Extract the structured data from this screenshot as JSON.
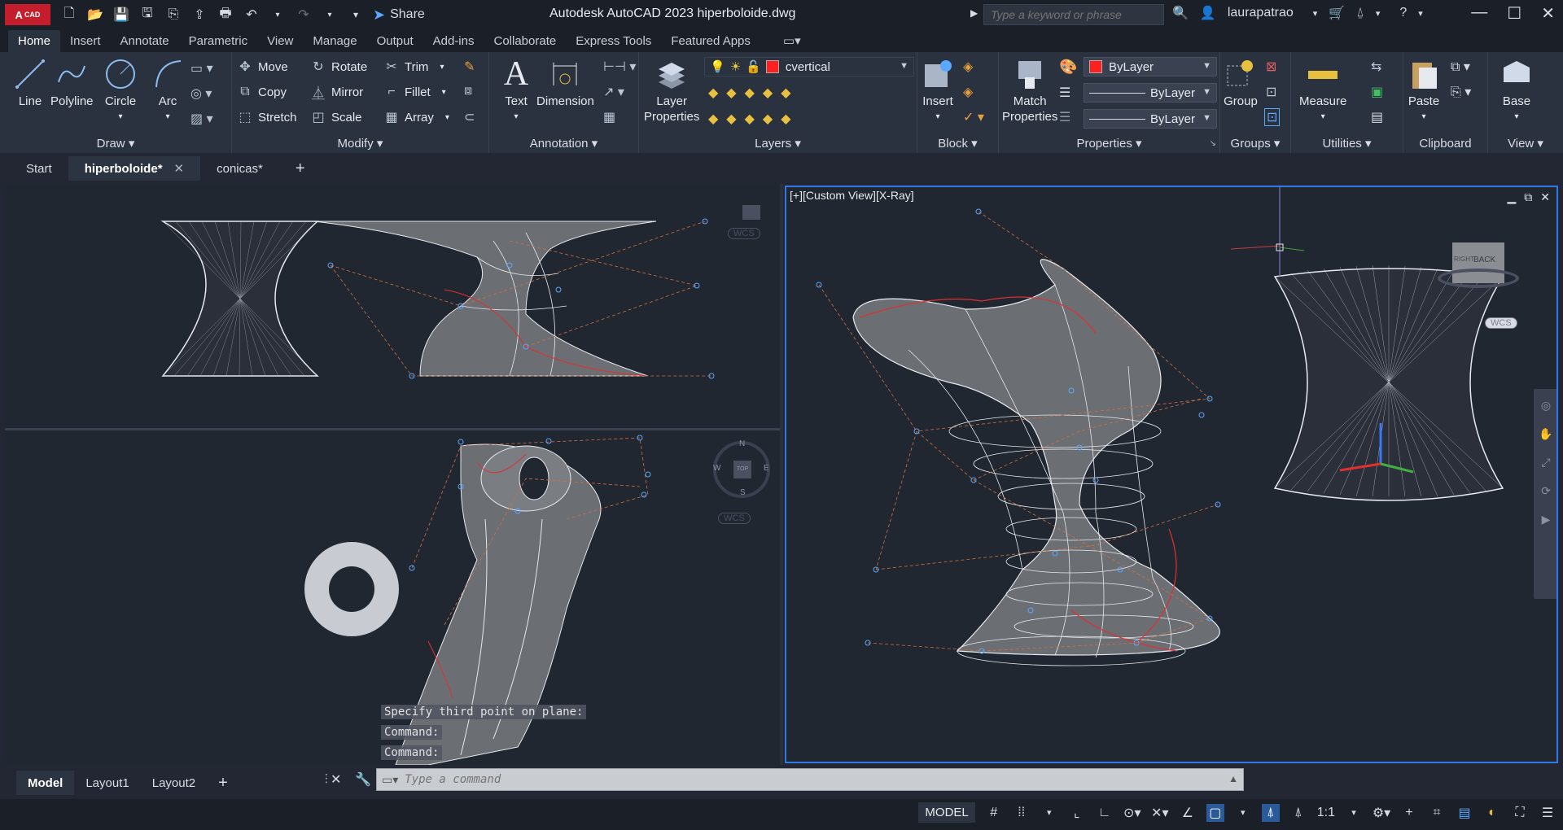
{
  "titlebar": {
    "app_badge": "A",
    "app_badge_small": "CAD",
    "share": "Share",
    "title": "Autodesk AutoCAD 2023   hiperboloide.dwg",
    "search_placeholder": "Type a keyword or phrase",
    "user": "laurapatrao"
  },
  "ribbon_tabs": [
    "Home",
    "Insert",
    "Annotate",
    "Parametric",
    "View",
    "Manage",
    "Output",
    "Add-ins",
    "Collaborate",
    "Express Tools",
    "Featured Apps"
  ],
  "ribbon": {
    "draw": {
      "title": "Draw",
      "line": "Line",
      "polyline": "Polyline",
      "circle": "Circle",
      "arc": "Arc"
    },
    "modify": {
      "title": "Modify",
      "move": "Move",
      "rotate": "Rotate",
      "trim": "Trim",
      "copy": "Copy",
      "mirror": "Mirror",
      "fillet": "Fillet",
      "stretch": "Stretch",
      "scale": "Scale",
      "array": "Array"
    },
    "annotation": {
      "title": "Annotation",
      "text": "Text",
      "dimension": "Dimension"
    },
    "layers": {
      "title": "Layers",
      "layer_properties_1": "Layer",
      "layer_properties_2": "Properties",
      "current_layer": "cvertical"
    },
    "block": {
      "title": "Block",
      "insert": "Insert"
    },
    "properties": {
      "title": "Properties",
      "match_1": "Match",
      "match_2": "Properties",
      "color": "ByLayer",
      "linetype": "ByLayer",
      "lineweight": "ByLayer"
    },
    "groups": {
      "title": "Groups",
      "group": "Group"
    },
    "utilities": {
      "title": "Utilities",
      "measure": "Measure"
    },
    "clipboard": {
      "title": "Clipboard",
      "paste": "Paste"
    },
    "view": {
      "title": "View",
      "base": "Base"
    }
  },
  "doc_tabs": {
    "start": "Start",
    "active": "hiperboloide*",
    "other": "conicas*"
  },
  "viewports": {
    "right_label": "[+][Custom View][X-Ray]",
    "compass": {
      "n": "N",
      "s": "S",
      "e": "E",
      "w": "W",
      "top": "TOP"
    },
    "viewcube_right": "RIGHT",
    "viewcube_back": "BACK",
    "wcs": "WCS"
  },
  "command_history": [
    "Specify third point on plane:",
    "Command:",
    "Command:"
  ],
  "layout_tabs": [
    "Model",
    "Layout1",
    "Layout2"
  ],
  "command_placeholder": "Type a command",
  "status": {
    "model": "MODEL",
    "scale": "1:1"
  }
}
